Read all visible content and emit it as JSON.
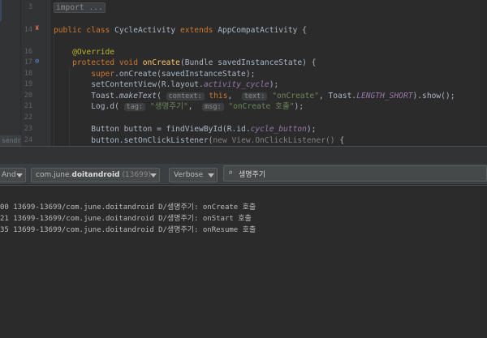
{
  "editor": {
    "send_tab_label": "sendr",
    "lines": [
      {
        "num": "3",
        "tokens": [
          {
            "c": "fold",
            "t": "import ..."
          }
        ]
      },
      {
        "num": "14",
        "tokens": [
          {
            "c": "kw",
            "t": "public class "
          },
          {
            "c": "",
            "t": "CycleActivity "
          },
          {
            "c": "kw",
            "t": "extends "
          },
          {
            "c": "",
            "t": "AppCompatActivity {"
          }
        ]
      },
      {
        "num": "16",
        "tokens": [
          {
            "c": "ann",
            "t": "    @Override"
          }
        ]
      },
      {
        "num": "17",
        "tokens": [
          {
            "c": "kw",
            "t": "    protected void "
          },
          {
            "c": "fn",
            "t": "onCreate"
          },
          {
            "c": "",
            "t": "(Bundle savedInstanceState) {"
          }
        ]
      },
      {
        "num": "18",
        "tokens": [
          {
            "c": "kw",
            "t": "        super"
          },
          {
            "c": "",
            "t": ".onCreate(savedInstanceState);"
          }
        ]
      },
      {
        "num": "19",
        "tokens": [
          {
            "c": "",
            "t": "        setContentView(R.layout."
          },
          {
            "c": "fld",
            "t": "activity_cycle"
          },
          {
            "c": "",
            "t": ");"
          }
        ]
      },
      {
        "num": "20",
        "tokens": [
          {
            "c": "",
            "t": "        Toast."
          },
          {
            "c": "ital-plain",
            "t": "makeText"
          },
          {
            "c": "",
            "t": "( "
          },
          {
            "c": "hint",
            "t": "context:"
          },
          {
            "c": "kw",
            "t": " this"
          },
          {
            "c": "",
            "t": ",  "
          },
          {
            "c": "hint",
            "t": "text:"
          },
          {
            "c": "str",
            "t": " \"onCreate\""
          },
          {
            "c": "",
            "t": ", Toast."
          },
          {
            "c": "fld",
            "t": "LENGTH_SHORT"
          },
          {
            "c": "",
            "t": ").show();"
          }
        ]
      },
      {
        "num": "21",
        "tokens": [
          {
            "c": "",
            "t": "        Log.d( "
          },
          {
            "c": "hint",
            "t": "tag:"
          },
          {
            "c": "str",
            "t": " \"생명주기\""
          },
          {
            "c": "",
            "t": ",  "
          },
          {
            "c": "hint",
            "t": "msg:"
          },
          {
            "c": "str",
            "t": " \"onCreate 호출\""
          },
          {
            "c": "",
            "t": ");"
          }
        ]
      },
      {
        "num": "22",
        "tokens": []
      },
      {
        "num": "23",
        "tokens": [
          {
            "c": "",
            "t": "        Button button = findViewById(R.id."
          },
          {
            "c": "fld",
            "t": "cycle_button"
          },
          {
            "c": "",
            "t": ");"
          }
        ]
      },
      {
        "num": "24",
        "tokens": [
          {
            "c": "",
            "t": "        button.setOnClickListener("
          },
          {
            "c": "gry",
            "t": "new View.OnClickListener() "
          },
          {
            "c": "",
            "t": "{"
          }
        ]
      }
    ]
  },
  "logcat": {
    "device_label": "And",
    "process_name_prefix": "com.june.",
    "process_name_bold": "doitandroid",
    "process_pid": "(13699)",
    "level": "Verbose",
    "search_query": "생명주기",
    "entries": [
      "00 13699-13699/com.june.doitandroid D/생명주기: onCreate 호출",
      "21 13699-13699/com.june.doitandroid D/생명주기: onStart 호출",
      "35 13699-13699/com.june.doitandroid D/생명주기: onResume 호출"
    ]
  },
  "colors": {
    "editor_bg": "#2b2b2b",
    "gutter_bg": "#313335",
    "keyword": "#cc7832",
    "string": "#6a8759",
    "method": "#ffc66d",
    "annotation": "#bbb529",
    "field": "#9876aa"
  },
  "icons": {
    "class_run_gutter": "run-icon",
    "override_gutter": "override-icon",
    "search": "search-icon",
    "dropdown": "chevron-down-icon"
  }
}
